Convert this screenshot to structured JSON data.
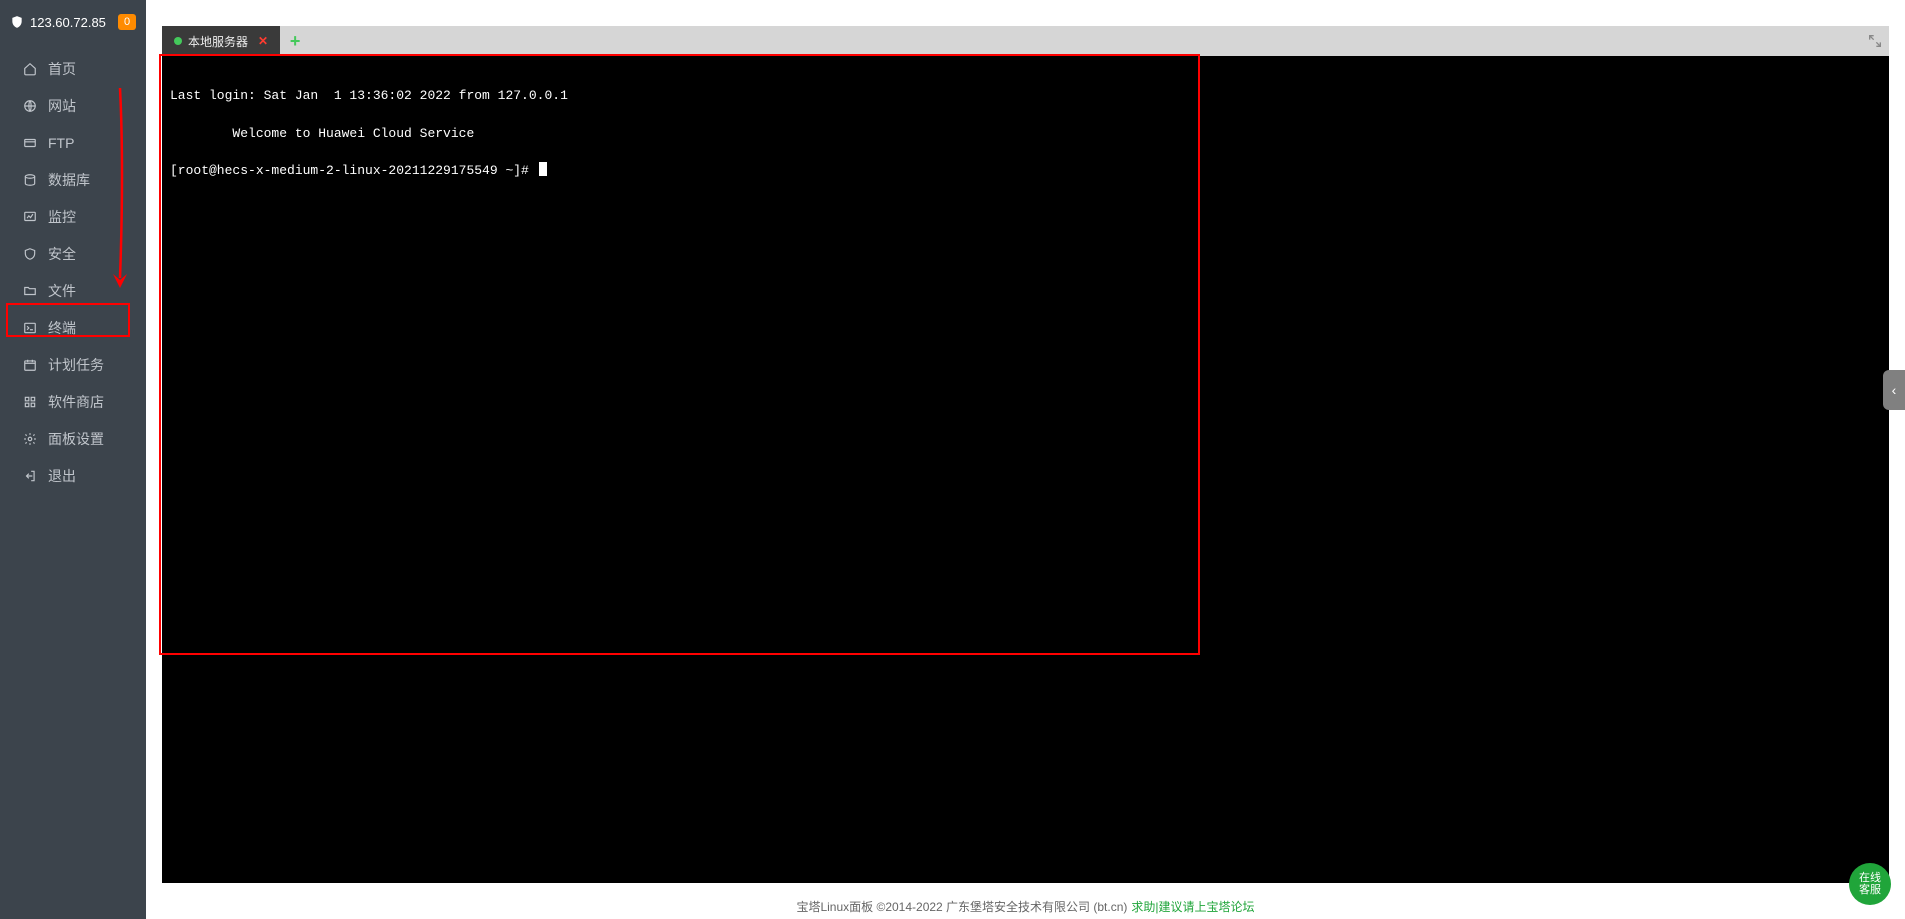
{
  "header": {
    "ip": "123.60.72.85",
    "notif_count": "0"
  },
  "sidebar": {
    "items": [
      {
        "label": "首页"
      },
      {
        "label": "网站"
      },
      {
        "label": "FTP"
      },
      {
        "label": "数据库"
      },
      {
        "label": "监控"
      },
      {
        "label": "安全"
      },
      {
        "label": "文件"
      },
      {
        "label": "终端"
      },
      {
        "label": "计划任务"
      },
      {
        "label": "软件商店"
      },
      {
        "label": "面板设置"
      },
      {
        "label": "退出"
      }
    ]
  },
  "tabs": {
    "items": [
      {
        "label": "本地服务器",
        "status": "connected"
      }
    ],
    "add_label": "+"
  },
  "terminal": {
    "lines": [
      "Last login: Sat Jan  1 13:36:02 2022 from 127.0.0.1",
      "",
      "        Welcome to Huawei Cloud Service",
      "",
      "[root@hecs-x-medium-2-linux-20211229175549 ~]# "
    ]
  },
  "footer": {
    "text1": "宝塔Linux面板 ©2014-2022 广东堡塔安全技术有限公司 (bt.cn) ",
    "link1": "求助|建议请上宝塔论坛"
  },
  "service_btn": "在线\n客服"
}
